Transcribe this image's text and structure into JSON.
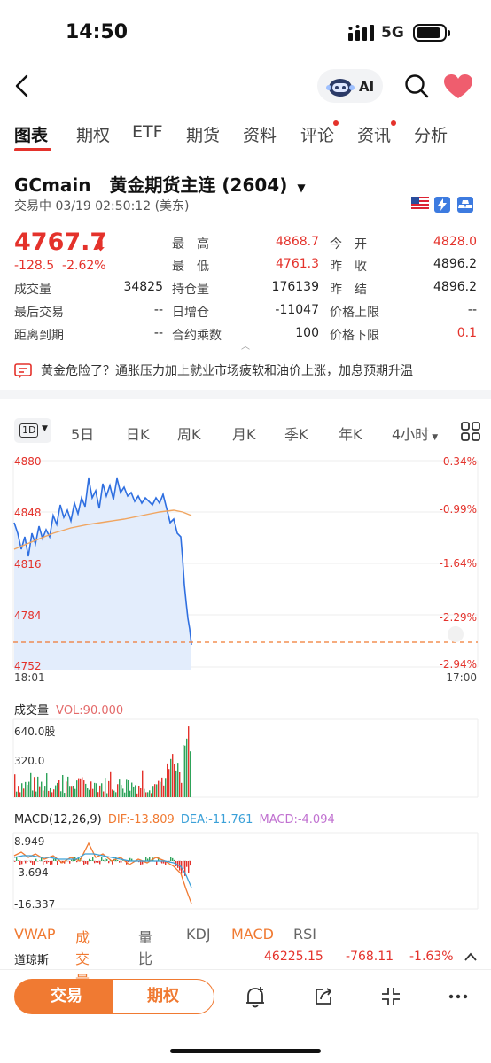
{
  "status_bar": {
    "time": "14:50",
    "network": "5G"
  },
  "header": {
    "ai_label": "AI"
  },
  "tabs": [
    {
      "label": "图表",
      "active": true,
      "dot": false
    },
    {
      "label": "期权",
      "active": false,
      "dot": false
    },
    {
      "label": "ETF",
      "active": false,
      "dot": false
    },
    {
      "label": "期货",
      "active": false,
      "dot": false
    },
    {
      "label": "资料",
      "active": false,
      "dot": false
    },
    {
      "label": "评论",
      "active": false,
      "dot": true
    },
    {
      "label": "资讯",
      "active": false,
      "dot": true
    },
    {
      "label": "分析",
      "active": false,
      "dot": false
    }
  ],
  "instrument": {
    "symbol": "GCmain",
    "name": "黄金期货主连 (2604)",
    "status": "交易中 03/19 02:50:12 (美东)",
    "price": "4767.7",
    "change": "-128.5",
    "change_pct": "-2.62%"
  },
  "stats": {
    "high_label": "最　高",
    "high": "4868.7",
    "low_label": "最　低",
    "low": "4761.3",
    "open_label": "今　开",
    "open": "4828.0",
    "prev_close_label": "昨　收",
    "prev_close": "4896.2",
    "prev_settle_label": "昨　结",
    "prev_settle": "4896.2",
    "volume_label": "成交量",
    "volume": "34825",
    "oi_label": "持仓量",
    "oi": "176139",
    "last_trade_label": "最后交易",
    "last_trade": "--",
    "daily_oi_label": "日增仓",
    "daily_oi": "-11047",
    "upper_limit_label": "价格上限",
    "upper_limit": "--",
    "to_expiry_label": "距离到期",
    "to_expiry": "--",
    "multiplier_label": "合约乘数",
    "multiplier": "100",
    "lower_limit_label": "价格下限",
    "lower_limit": "0.1"
  },
  "news": {
    "text": "黄金危险了？通胀压力加上就业市场疲软和油价上涨，加息预期升温"
  },
  "periods": [
    "1D",
    "5日",
    "日K",
    "周K",
    "月K",
    "季K",
    "年K",
    "4小时"
  ],
  "chart": {
    "y_left": [
      "4880",
      "4848",
      "4816",
      "4784",
      "4752"
    ],
    "y_right": [
      "-0.34%",
      "-0.99%",
      "-1.64%",
      "-2.29%",
      "-2.94%"
    ],
    "x_start": "18:01",
    "x_end": "17:00"
  },
  "volume": {
    "title": "成交量",
    "vol": "VOL:90.000",
    "max_label": "640.0股",
    "mid_label": "320.0"
  },
  "macd": {
    "title": "MACD(12,26,9)",
    "dif": "DIF:-13.809",
    "dea": "DEA:-11.761",
    "macd": "MACD:-4.094",
    "top": "8.949",
    "mid": "-3.694",
    "bottom": "-16.337"
  },
  "indicators": [
    {
      "label": "VWAP",
      "active": true
    },
    {
      "label": "成交量",
      "active": true
    },
    {
      "label": "量比",
      "active": false
    },
    {
      "label": "KDJ",
      "active": false
    },
    {
      "label": "MACD",
      "active": true
    },
    {
      "label": "RSI",
      "active": false
    }
  ],
  "ticker": {
    "name": "道琼斯",
    "price": "46225.15",
    "change": "-768.11",
    "pct": "-1.63%"
  },
  "bottom": {
    "trade": "交易",
    "option": "期权"
  },
  "colors": {
    "red": "#e4322b",
    "orange": "#f07a32",
    "blue": "#2f6fe0",
    "green": "#2ea35a"
  }
}
